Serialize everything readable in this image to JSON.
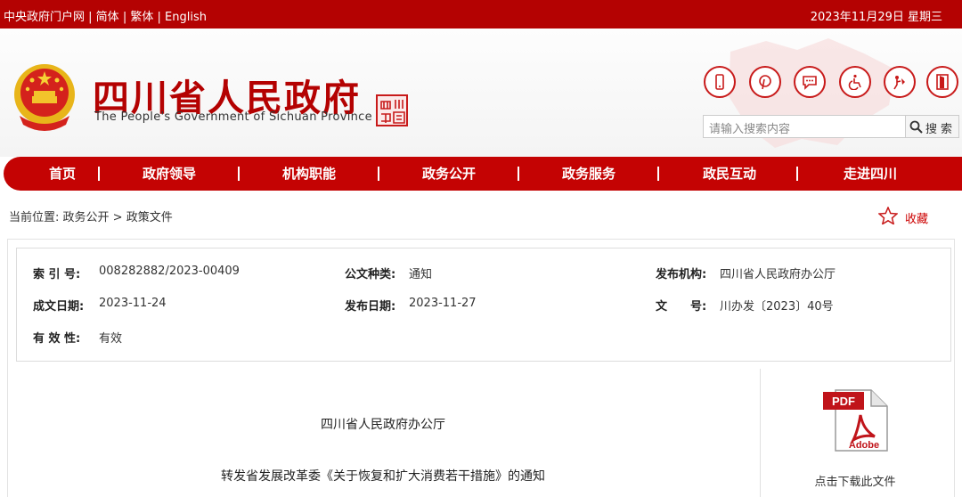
{
  "topbar": {
    "links": [
      "中央政府门户网",
      "简体",
      "繁体",
      "English"
    ],
    "separator": " | ",
    "date": "2023年11月29日 星期三"
  },
  "header": {
    "title_cn": "四川省人民政府",
    "title_en": "The People's Government of Sichuan Province",
    "seal_chars": "四川中国",
    "icons": [
      "mobile-icon",
      "pinterest-icon",
      "message-icon",
      "accessibility-icon",
      "elderly-care-icon",
      "exit-icon"
    ],
    "search_placeholder": "请输入搜索内容",
    "search_button": "搜索",
    "accent": "#b40202"
  },
  "nav": {
    "items": [
      "首页",
      "政府领导",
      "机构职能",
      "政务公开",
      "政务服务",
      "政民互动",
      "走进四川"
    ]
  },
  "breadcrumb": {
    "prefix": "当前位置:",
    "path": "政务公开 > 政策文件",
    "favorite": "收藏"
  },
  "info": {
    "index_label": "索 引 号:",
    "index_value": "008282882/2023-00409",
    "category_label": "公文种类:",
    "category_value": "通知",
    "publisher_label": "发布机构:",
    "publisher_value": "四川省人民政府办公厅",
    "created_label": "成文日期:",
    "created_value": "2023-11-24",
    "published_label": "发布日期:",
    "published_value": "2023-11-27",
    "docno_label": "文　　号:",
    "docno_value": "川办发〔2023〕40号",
    "validity_label": "有 效 性:",
    "validity_value": "有效"
  },
  "content": {
    "issuer": "四川省人民政府办公厅",
    "title": "转发省发展改革委《关于恢复和扩大消费若干措施》的通知",
    "download_caption": "点击下载此文件",
    "pdf_label": "PDF",
    "pdf_brand": "Adobe"
  }
}
